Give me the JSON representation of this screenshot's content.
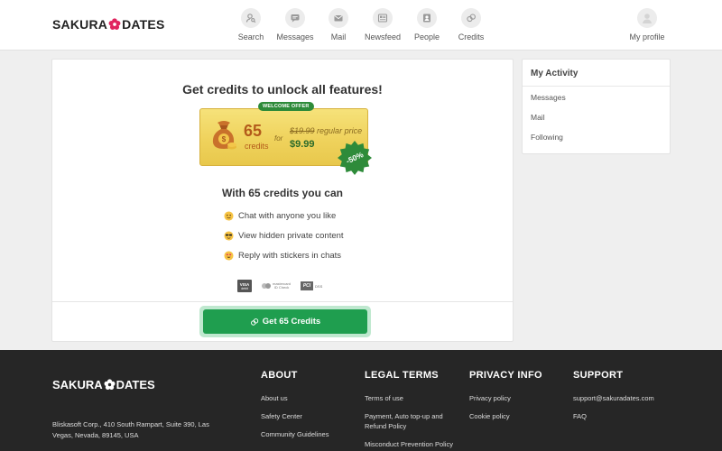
{
  "brand": {
    "left": "SAKURA",
    "right": "DATES"
  },
  "nav": {
    "items": [
      {
        "label": "Search",
        "icon": "search-people-icon"
      },
      {
        "label": "Messages",
        "icon": "chat-bubble-icon"
      },
      {
        "label": "Mail",
        "icon": "envelope-icon"
      },
      {
        "label": "Newsfeed",
        "icon": "newsfeed-icon"
      },
      {
        "label": "People",
        "icon": "person-card-icon"
      },
      {
        "label": "Credits",
        "icon": "coins-icon"
      }
    ],
    "profile_label": "My profile"
  },
  "offer": {
    "title": "Get credits to unlock all features!",
    "badge": "WELCOME OFFER",
    "credits_amount": "65",
    "credits_word": "credits",
    "for_word": "for",
    "old_price": "$19.99",
    "old_price_suffix": "regular price",
    "new_price": "$9.99",
    "discount": "-50%",
    "accent_color": "#2e8b3a",
    "gold_color": "#efd25c"
  },
  "features": {
    "heading": "With 65 credits you can",
    "items": [
      {
        "label": "Chat with anyone you like",
        "icon": "wave-emoji-icon"
      },
      {
        "label": "View hidden private content",
        "icon": "sunglasses-emoji-icon"
      },
      {
        "label": "Reply with stickers in chats",
        "icon": "heart-eyes-emoji-icon"
      }
    ]
  },
  "payments": {
    "visa": "VISA",
    "visa_sub": "debit",
    "mastercard": "mastercard",
    "mastercard_sub": "ID Check",
    "pci": "PCI",
    "pci_sub": "DSS"
  },
  "cta": {
    "label": "Get 65 Credits",
    "color": "#1f9e4f"
  },
  "activity": {
    "title": "My Activity",
    "links": [
      "Messages",
      "Mail",
      "Following"
    ]
  },
  "footer": {
    "address": "Bliskasoft Corp., 410 South Rampart, Suite 390, Las Vegas, Nevada, 89145, USA",
    "columns": [
      {
        "title": "ABOUT",
        "links": [
          "About us",
          "Safety Center",
          "Community Guidelines"
        ]
      },
      {
        "title": "LEGAL TERMS",
        "links": [
          "Terms of use",
          "Payment, Auto top-up and Refund Policy",
          "Misconduct Prevention Policy"
        ]
      },
      {
        "title": "PRIVACY INFO",
        "links": [
          "Privacy policy",
          "Cookie policy"
        ]
      },
      {
        "title": "SUPPORT",
        "links": [
          "support@sakuradates.com",
          "FAQ"
        ]
      }
    ]
  }
}
